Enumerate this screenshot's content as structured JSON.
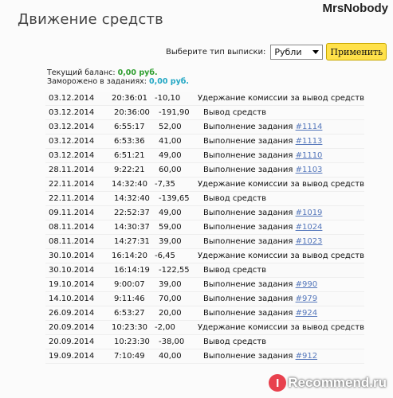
{
  "header": {
    "title": "Движение средств",
    "user_watermark": "MrsNobody"
  },
  "filter": {
    "label": "Выберите тип выписки:",
    "selected": "Рубли",
    "apply_label": "Применить"
  },
  "balance": {
    "current_label": "Текущий баланс:",
    "current_value": "0,00 руб.",
    "frozen_label": "Заморожено в заданиях:",
    "frozen_value": "0,00 руб."
  },
  "transactions": [
    {
      "date": "03.12.2014",
      "time": "20:36:01",
      "amount": "-10,10",
      "desc": "Удержание комиссии за вывод средств",
      "link": ""
    },
    {
      "date": "03.12.2014",
      "time": "20:36:00",
      "amount": "-191,90",
      "desc": "Вывод средств",
      "link": ""
    },
    {
      "date": "03.12.2014",
      "time": "6:55:17",
      "amount": "52,00",
      "desc": "Выполнение задания",
      "link": "#1114"
    },
    {
      "date": "03.12.2014",
      "time": "6:53:36",
      "amount": "41,00",
      "desc": "Выполнение задания",
      "link": "#1113"
    },
    {
      "date": "03.12.2014",
      "time": "6:51:21",
      "amount": "49,00",
      "desc": "Выполнение задания",
      "link": "#1110"
    },
    {
      "date": "28.11.2014",
      "time": "9:22:21",
      "amount": "60,00",
      "desc": "Выполнение задания",
      "link": "#1103"
    },
    {
      "date": "22.11.2014",
      "time": "14:32:40",
      "amount": "-7,35",
      "desc": "Удержание комиссии за вывод средств",
      "link": ""
    },
    {
      "date": "22.11.2014",
      "time": "14:32:40",
      "amount": "-139,65",
      "desc": "Вывод средств",
      "link": ""
    },
    {
      "date": "09.11.2014",
      "time": "22:52:37",
      "amount": "49,00",
      "desc": "Выполнение задания",
      "link": "#1019"
    },
    {
      "date": "08.11.2014",
      "time": "14:30:37",
      "amount": "59,00",
      "desc": "Выполнение задания",
      "link": "#1024"
    },
    {
      "date": "08.11.2014",
      "time": "14:27:31",
      "amount": "39,00",
      "desc": "Выполнение задания",
      "link": "#1023"
    },
    {
      "date": "30.10.2014",
      "time": "16:14:20",
      "amount": "-6,45",
      "desc": "Удержание комиссии за вывод средств",
      "link": ""
    },
    {
      "date": "30.10.2014",
      "time": "16:14:19",
      "amount": "-122,55",
      "desc": "Вывод средств",
      "link": ""
    },
    {
      "date": "19.10.2014",
      "time": "9:00:07",
      "amount": "39,00",
      "desc": "Выполнение задания",
      "link": "#990"
    },
    {
      "date": "14.10.2014",
      "time": "9:11:46",
      "amount": "70,00",
      "desc": "Выполнение задания",
      "link": "#979"
    },
    {
      "date": "26.09.2014",
      "time": "6:53:27",
      "amount": "20,00",
      "desc": "Выполнение задания",
      "link": "#924"
    },
    {
      "date": "20.09.2014",
      "time": "10:23:30",
      "amount": "-2,00",
      "desc": "Удержание комиссии за вывод средств",
      "link": ""
    },
    {
      "date": "20.09.2014",
      "time": "10:23:30",
      "amount": "-38,00",
      "desc": "Вывод средств",
      "link": ""
    },
    {
      "date": "19.09.2014",
      "time": "7:10:49",
      "amount": "40,00",
      "desc": "Выполнение задания",
      "link": "#912"
    }
  ],
  "footer_watermark": {
    "logo_letter": "I",
    "text": "Recommend.ru"
  },
  "colors": {
    "apply_button": "#ffe14a",
    "balance_current": "#2e9e2e",
    "balance_frozen": "#23a7c4",
    "link": "#5577bb"
  }
}
